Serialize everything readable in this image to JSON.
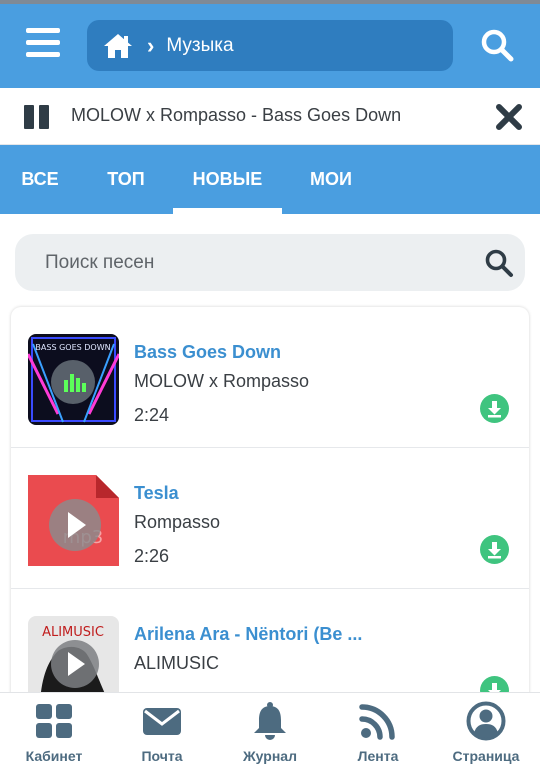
{
  "header": {
    "breadcrumb_label": "Музыка",
    "menu_icon": "menu-icon",
    "home_icon": "home-icon",
    "search_icon": "search-icon"
  },
  "player": {
    "track_title": "MOLOW x Rompasso - Bass Goes Down"
  },
  "tabs": [
    {
      "label": "ВСЕ"
    },
    {
      "label": "ТОП"
    },
    {
      "label": "НОВЫЕ",
      "active": true
    },
    {
      "label": "МОИ"
    }
  ],
  "song_search": {
    "placeholder": "Поиск песен"
  },
  "songs": [
    {
      "title": "Bass Goes Down",
      "artist": "MOLOW x Rompasso",
      "duration": "2:24",
      "cover_text": "BASS GOES DOWN"
    },
    {
      "title": "Tesla",
      "artist": "Rompasso",
      "duration": "2:26",
      "cover_text": "mp3"
    },
    {
      "title": "Arilena Ara - Nëntori (Be ...",
      "artist": "ALIMUSIC",
      "duration": "",
      "cover_text": "ALIMUSIC"
    }
  ],
  "bottom_nav": [
    {
      "label": "Кабинет",
      "icon": "grid-icon"
    },
    {
      "label": "Почта",
      "icon": "mail-icon"
    },
    {
      "label": "Журнал",
      "icon": "bell-icon"
    },
    {
      "label": "Лента",
      "icon": "rss-icon"
    },
    {
      "label": "Страница",
      "icon": "user-icon"
    }
  ],
  "colors": {
    "brand_blue": "#4a9ee0",
    "link_blue": "#3b8fd0",
    "download_green": "#3fc47f"
  }
}
